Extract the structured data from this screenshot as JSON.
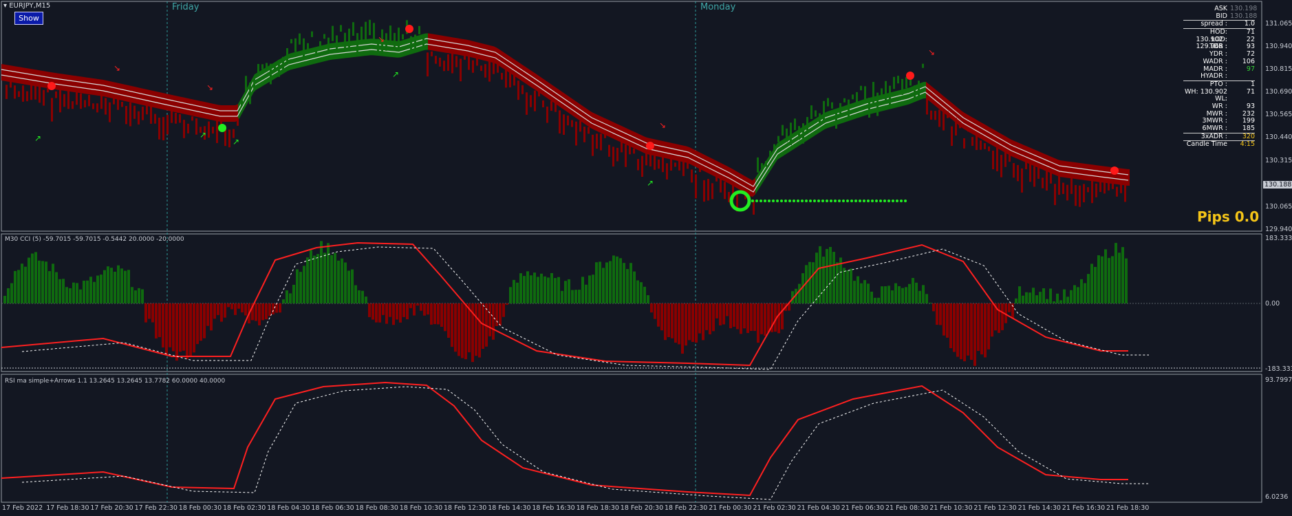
{
  "window": {
    "symbol": "EURJPY,M15"
  },
  "show_button": {
    "label": "Show"
  },
  "day_separators": [
    {
      "label": "Friday"
    },
    {
      "label": "Monday"
    }
  ],
  "price_axis": {
    "labels": [
      "131.065",
      "130.940",
      "130.815",
      "130.690",
      "130.565",
      "130.440",
      "130.315",
      "130.065",
      "129.940"
    ],
    "current_price": "130.188"
  },
  "info_panel": {
    "ask_label": "ASK",
    "ask_value": "130.198",
    "bid_label": "BID",
    "bid_value": "130.188",
    "rows": [
      {
        "k": "spread :",
        "v": "1.0",
        "color": "#ffffff"
      },
      {
        "k": "HOD: 130.902 :",
        "v": "71",
        "color": "#ffffff"
      },
      {
        "k": "LOD: 129.968 :",
        "v": "22",
        "color": "#ffffff"
      },
      {
        "k": "TDR :",
        "v": "93",
        "color": "#ffffff"
      },
      {
        "k": "YDR :",
        "v": "72",
        "color": "#ffffff"
      },
      {
        "k": "WADR :",
        "v": "106",
        "color": "#ffffff"
      },
      {
        "k": "MADR :",
        "v": "97",
        "color": "#35d435"
      },
      {
        "k": "HYADR :",
        "v": "",
        "color": "#35d435"
      },
      {
        "k": "PTO :",
        "v": "1",
        "color": "#ffffff"
      },
      {
        "k": "WH: 130.902 :",
        "v": "71",
        "color": "#ffffff"
      },
      {
        "k": "WL:",
        "v": "",
        "color": "#ffffff"
      },
      {
        "k": "WR :",
        "v": "93",
        "color": "#ffffff"
      },
      {
        "k": "MWR :",
        "v": "232",
        "color": "#ffffff"
      },
      {
        "k": "3MWR :",
        "v": "199",
        "color": "#ffffff"
      },
      {
        "k": "6MWR :",
        "v": "185",
        "color": "#ffffff"
      },
      {
        "k": "3xADR :",
        "v": "320",
        "color": "#f5c518"
      },
      {
        "k": "Candle Time",
        "v": "4:15",
        "color": "#f5c518"
      }
    ]
  },
  "pips": {
    "label": "Pips 0.0"
  },
  "cci_panel": {
    "title": "M30 CCI (5) -59.7015 -59.7015 -0.5442 20.0000 -20.0000",
    "axis": [
      "183.3333",
      "0.00",
      "-183.3333"
    ]
  },
  "rsi_panel": {
    "title": "RSI ma simple+Arrows 1.1 13.2645 13.2645 13.7782 60.0000 40.0000",
    "axis": [
      "93.7997",
      "6.0236"
    ]
  },
  "time_axis": [
    "17 Feb 2022",
    "17 Feb 18:30",
    "17 Feb 20:30",
    "17 Feb 22:30",
    "18 Feb 00:30",
    "18 Feb 02:30",
    "18 Feb 04:30",
    "18 Feb 06:30",
    "18 Feb 08:30",
    "18 Feb 10:30",
    "18 Feb 12:30",
    "18 Feb 14:30",
    "18 Feb 16:30",
    "18 Feb 18:30",
    "18 Feb 20:30",
    "18 Feb 22:30",
    "21 Feb 00:30",
    "21 Feb 02:30",
    "21 Feb 04:30",
    "21 Feb 06:30",
    "21 Feb 08:30",
    "21 Feb 10:30",
    "21 Feb 12:30",
    "21 Feb 14:30",
    "21 Feb 16:30",
    "21 Feb 18:30"
  ],
  "colors": {
    "bull": "#0f6b0f",
    "bear": "#8b0000",
    "line_green": "#39e239",
    "line_red": "#ff2020",
    "separator": "#2e9b9b",
    "background": "#131722"
  }
}
